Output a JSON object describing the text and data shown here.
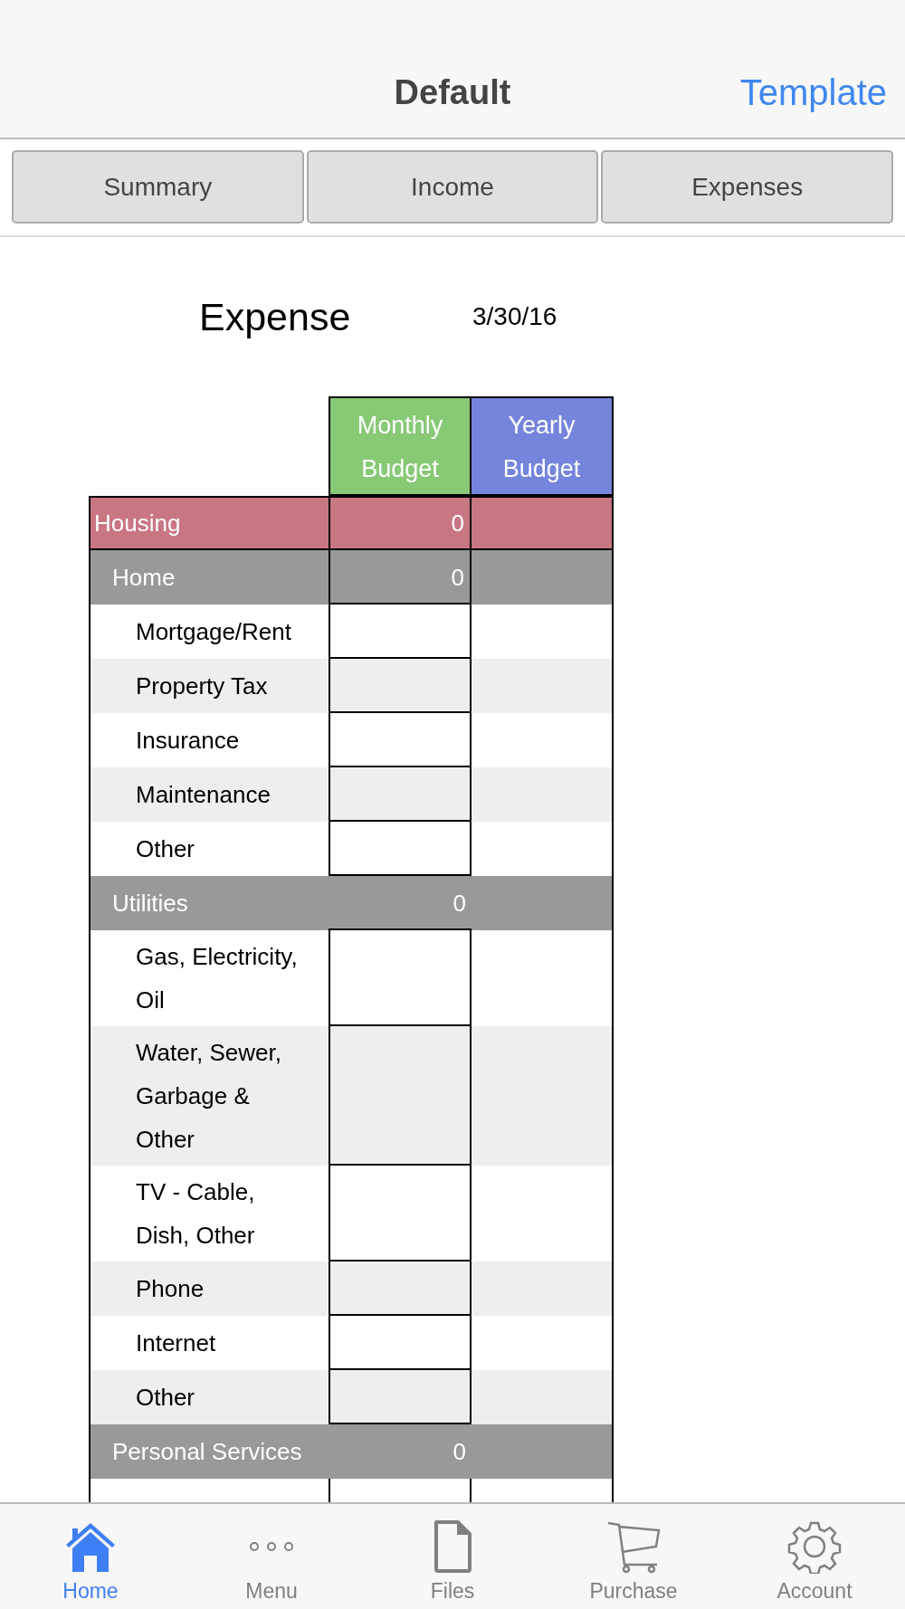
{
  "nav": {
    "title": "Default",
    "action": "Template"
  },
  "segments": [
    {
      "label": "Summary",
      "selected": false
    },
    {
      "label": "Income",
      "selected": false
    },
    {
      "label": "Expenses",
      "selected": false
    }
  ],
  "sheet": {
    "title": "Expense",
    "date": "3/30/16",
    "columns": [
      {
        "label": "Monthly\nBudget",
        "color": "#88c976"
      },
      {
        "label": "Yearly\nBudget",
        "color": "#7585dc"
      }
    ],
    "rows": [
      {
        "kind": "category",
        "label": "Housing",
        "monthly": "0"
      },
      {
        "kind": "group",
        "label": "Home",
        "monthly": "0",
        "boxed": true
      },
      {
        "kind": "item",
        "label": "Mortgage/Rent"
      },
      {
        "kind": "item",
        "label": "Property Tax"
      },
      {
        "kind": "item",
        "label": "Insurance"
      },
      {
        "kind": "item",
        "label": "Maintenance"
      },
      {
        "kind": "item",
        "label": "Other"
      },
      {
        "kind": "group",
        "label": "Utilities",
        "monthly": "0",
        "boxed": false
      },
      {
        "kind": "item",
        "label": "Gas, Electricity,\nOil"
      },
      {
        "kind": "item",
        "label": "Water, Sewer,\nGarbage &\nOther"
      },
      {
        "kind": "item",
        "label": "TV - Cable,\nDish, Other"
      },
      {
        "kind": "item",
        "label": "Phone"
      },
      {
        "kind": "item",
        "label": "Internet"
      },
      {
        "kind": "item",
        "label": "Other"
      },
      {
        "kind": "group",
        "label": "Personal Services",
        "monthly": "0",
        "boxed": false
      },
      {
        "kind": "item"
      }
    ]
  },
  "tabbar": [
    {
      "label": "Home",
      "selected": true
    },
    {
      "label": "Menu",
      "selected": false
    },
    {
      "label": "Files",
      "selected": false
    },
    {
      "label": "Purchase",
      "selected": false
    },
    {
      "label": "Account",
      "selected": false
    }
  ]
}
